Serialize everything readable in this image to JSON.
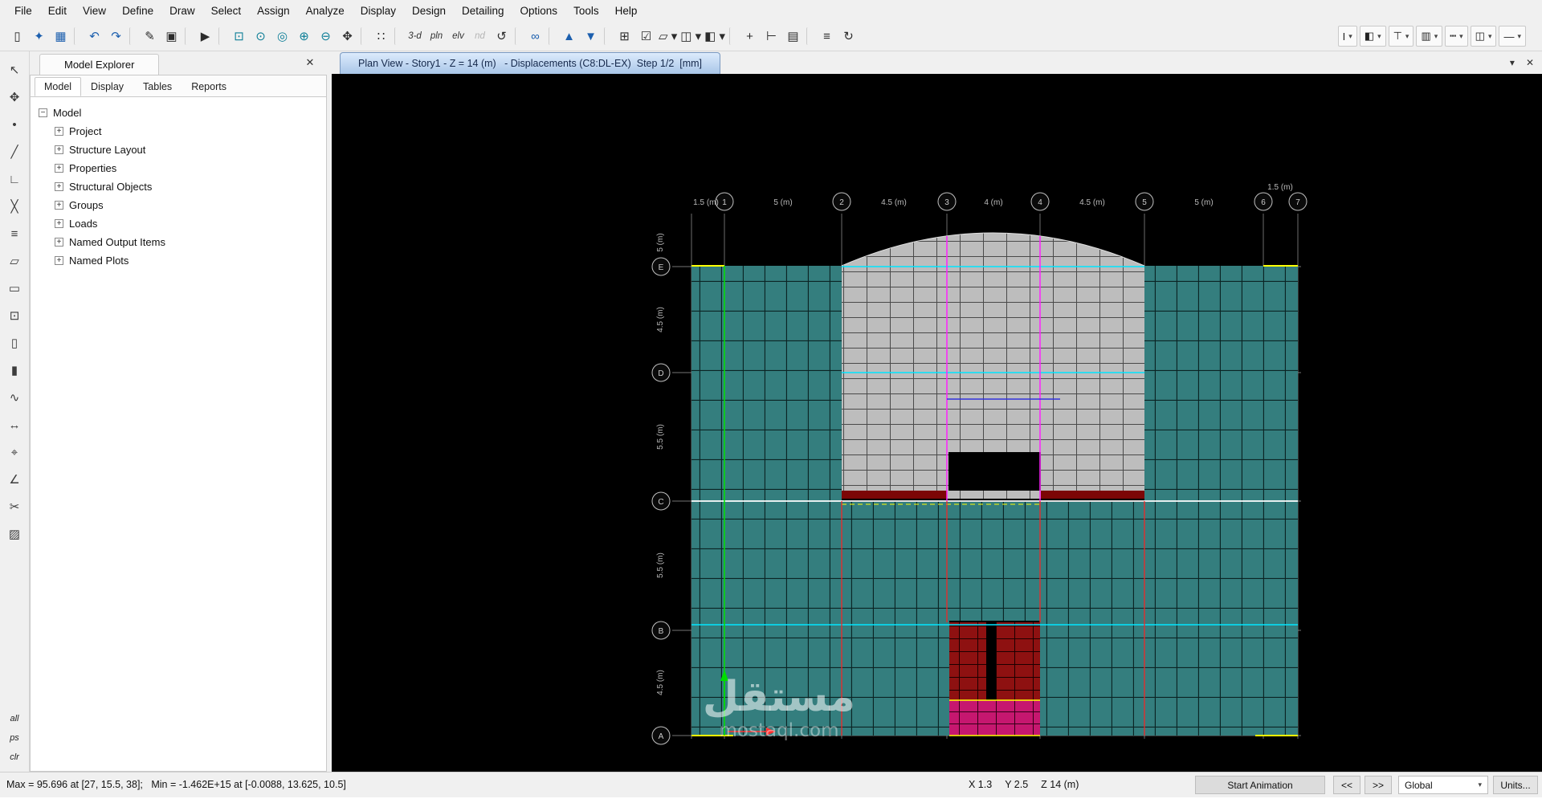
{
  "glyphs": {
    "caret": "▾",
    "close": "✕",
    "minus": "−",
    "plus": "+"
  },
  "menu": {
    "items": [
      "File",
      "Edit",
      "View",
      "Define",
      "Draw",
      "Select",
      "Assign",
      "Analyze",
      "Display",
      "Design",
      "Detailing",
      "Options",
      "Tools",
      "Help"
    ]
  },
  "toolbar": {
    "icons": [
      {
        "name": "new-model-icon",
        "glyph": "▯"
      },
      {
        "name": "open-model-icon",
        "glyph": "✦",
        "tone": "blue"
      },
      {
        "name": "save-model-icon",
        "glyph": "▦",
        "tone": "blue"
      },
      {
        "name": "toolbar-separator",
        "glyph": "",
        "tone": "sep"
      },
      {
        "name": "undo-icon",
        "glyph": "↶",
        "tone": "blue"
      },
      {
        "name": "redo-icon",
        "glyph": "↷",
        "tone": "blue"
      },
      {
        "name": "toolbar-separator",
        "glyph": "",
        "tone": "sep"
      },
      {
        "name": "edit-pencil-icon",
        "glyph": "✎"
      },
      {
        "name": "lock-model-icon",
        "glyph": "▣"
      },
      {
        "name": "toolbar-separator",
        "glyph": "",
        "tone": "sep"
      },
      {
        "name": "run-analysis-icon",
        "glyph": "▶"
      },
      {
        "name": "toolbar-separator",
        "glyph": "",
        "tone": "sep"
      },
      {
        "name": "rubber-band-zoom-icon",
        "glyph": "⊡",
        "tone": "teal"
      },
      {
        "name": "restore-full-view-icon",
        "glyph": "⊙",
        "tone": "teal"
      },
      {
        "name": "previous-zoom-icon",
        "glyph": "◎",
        "tone": "teal"
      },
      {
        "name": "zoom-in-icon",
        "glyph": "⊕",
        "tone": "teal"
      },
      {
        "name": "zoom-out-icon",
        "glyph": "⊖",
        "tone": "teal"
      },
      {
        "name": "pan-icon",
        "glyph": "✥"
      },
      {
        "name": "toolbar-separator",
        "glyph": "",
        "tone": "sep"
      },
      {
        "name": "snap-options-icon",
        "glyph": "∷"
      },
      {
        "name": "toolbar-separator",
        "glyph": "",
        "tone": "sep"
      },
      {
        "name": "three-d-view-icon",
        "glyph": "3-d",
        "tone": "txt"
      },
      {
        "name": "plan-view-icon",
        "glyph": "pln",
        "tone": "txt"
      },
      {
        "name": "elevation-view-icon",
        "glyph": "elv",
        "tone": "txt"
      },
      {
        "name": "named-display-icon",
        "glyph": "nd",
        "tone": "txtdim"
      },
      {
        "name": "rotate-view-icon",
        "glyph": "↺"
      },
      {
        "name": "toolbar-separator",
        "glyph": "",
        "tone": "sep"
      },
      {
        "name": "display-options-icon",
        "glyph": "∞",
        "tone": "blue"
      },
      {
        "name": "toolbar-separator",
        "glyph": "",
        "tone": "sep"
      },
      {
        "name": "move-up-story-icon",
        "glyph": "▲",
        "tone": "blue"
      },
      {
        "name": "move-down-story-icon",
        "glyph": "▼",
        "tone": "blue"
      },
      {
        "name": "toolbar-separator",
        "glyph": "",
        "tone": "sep"
      },
      {
        "name": "grid-options-icon",
        "glyph": "⊞"
      },
      {
        "name": "shrink-toggle-icon",
        "glyph": "☑"
      },
      {
        "name": "view-type-dropdown-icon",
        "glyph": "▱ ▾"
      },
      {
        "name": "object-cube-dropdown-icon",
        "glyph": "◫ ▾"
      },
      {
        "name": "section-cube-dropdown-icon",
        "glyph": "◧ ▾"
      },
      {
        "name": "toolbar-separator",
        "glyph": "",
        "tone": "sep"
      },
      {
        "name": "assign-joint-icon",
        "glyph": "+"
      },
      {
        "name": "assign-frame-icon",
        "glyph": "⊢"
      },
      {
        "name": "assign-shell-icon",
        "glyph": "▤"
      },
      {
        "name": "toolbar-separator",
        "glyph": "",
        "tone": "sep"
      },
      {
        "name": "story-list-icon",
        "glyph": "≡"
      },
      {
        "name": "refresh-window-icon",
        "glyph": "↻"
      }
    ],
    "right_groups": [
      {
        "name": "frame-sections-dropdown",
        "glyph": "I"
      },
      {
        "name": "wall-sections-dropdown",
        "glyph": "◧"
      },
      {
        "name": "supports-dropdown",
        "glyph": "⊤"
      },
      {
        "name": "slab-sections-dropdown",
        "glyph": "▥"
      },
      {
        "name": "line-pattern-dropdown",
        "glyph": "┅"
      },
      {
        "name": "views-dropdown",
        "glyph": "◫"
      },
      {
        "name": "draw-options-dropdown",
        "glyph": "—"
      }
    ]
  },
  "left_toolbar": {
    "icons": [
      {
        "name": "select-pointer-icon",
        "glyph": "↖"
      },
      {
        "name": "reshape-object-icon",
        "glyph": "✥"
      },
      {
        "name": "draw-joint-icon",
        "glyph": "•"
      },
      {
        "name": "draw-frame-icon",
        "glyph": "╱"
      },
      {
        "name": "quick-draw-frame-icon",
        "glyph": "∟"
      },
      {
        "name": "quick-draw-braces-icon",
        "glyph": "╳"
      },
      {
        "name": "quick-draw-beams-icon",
        "glyph": "≡"
      },
      {
        "name": "draw-floor-area-icon",
        "glyph": "▱"
      },
      {
        "name": "draw-rect-area-icon",
        "glyph": "▭"
      },
      {
        "name": "quick-draw-area-icon",
        "glyph": "⊡"
      },
      {
        "name": "draw-wall-icon",
        "glyph": "▯"
      },
      {
        "name": "quick-draw-wall-icon",
        "glyph": "▮"
      },
      {
        "name": "draw-link-icon",
        "glyph": "∿"
      },
      {
        "name": "draw-dimension-icon",
        "glyph": "↔"
      },
      {
        "name": "draw-reference-point-icon",
        "glyph": "⌖"
      },
      {
        "name": "measure-tool-icon",
        "glyph": "∠"
      },
      {
        "name": "section-cut-icon",
        "glyph": "✂"
      },
      {
        "name": "draw-cladding-icon",
        "glyph": "▨"
      },
      {
        "name": "left-toolbar-spacer",
        "glyph": "",
        "tone": "spacer"
      },
      {
        "name": "select-all-button",
        "glyph": "all",
        "tone": "txt"
      },
      {
        "name": "previous-selection-button",
        "glyph": "ps",
        "tone": "txt"
      },
      {
        "name": "clear-selection-button",
        "glyph": "clr",
        "tone": "txt"
      }
    ]
  },
  "explorer": {
    "title": "Model Explorer",
    "tabs": [
      "Model",
      "Display",
      "Tables",
      "Reports"
    ],
    "tree_root": "Model",
    "tree_items": [
      "Project",
      "Structure Layout",
      "Properties",
      "Structural Objects",
      "Groups",
      "Loads",
      "Named Output Items",
      "Named Plots"
    ]
  },
  "view": {
    "tab_title": "Plan View - Story1 - Z = 14 (m)   - Displacements (C8:DL-EX)  Step 1/2  [mm]"
  },
  "plan": {
    "top_dims": [
      "1.5 (m)",
      "5 (m)",
      "4.5 (m)",
      "4 (m)",
      "4.5 (m)",
      "5 (m)",
      "1.5 (m)"
    ],
    "left_dims": [
      "5 (m)",
      "4.5 (m)",
      "5.5 (m)",
      "5.5 (m)",
      "4.5 (m)"
    ],
    "top_grid_labels": [
      "1",
      "2",
      "3",
      "4",
      "5",
      "6",
      "7"
    ],
    "left_grid_labels": [
      "E",
      "D",
      "C",
      "B",
      "A"
    ],
    "colors": {
      "shell_teal": "#347e7e",
      "shell_gray": "#bdbdbd",
      "wall_red": "#8e1111",
      "wall_magenta": "#c6176f",
      "opening_black": "#000000",
      "grid_line": "#9a9a9a",
      "gridline_green": "#00e000",
      "gridline_cyan": "#00e5ff",
      "gridline_magenta": "#ff20ff",
      "gridline_red": "#ff2222",
      "edge_yellow": "#ffff00"
    }
  },
  "watermark": {
    "arabic": "مستقل",
    "domain": "mostaql.com"
  },
  "statusbar": {
    "results": "Max = 95.696 at [27, 15.5, 38];   Min = -1.462E+15 at [-0.0088, 13.625, 10.5]",
    "coord_x": "X 1.3",
    "coord_y": "Y 2.5",
    "coord_z": "Z 14 (m)",
    "start_animation": "Start Animation",
    "step_back": "<<",
    "step_forward": ">>",
    "coord_system": "Global",
    "units": "Units..."
  }
}
